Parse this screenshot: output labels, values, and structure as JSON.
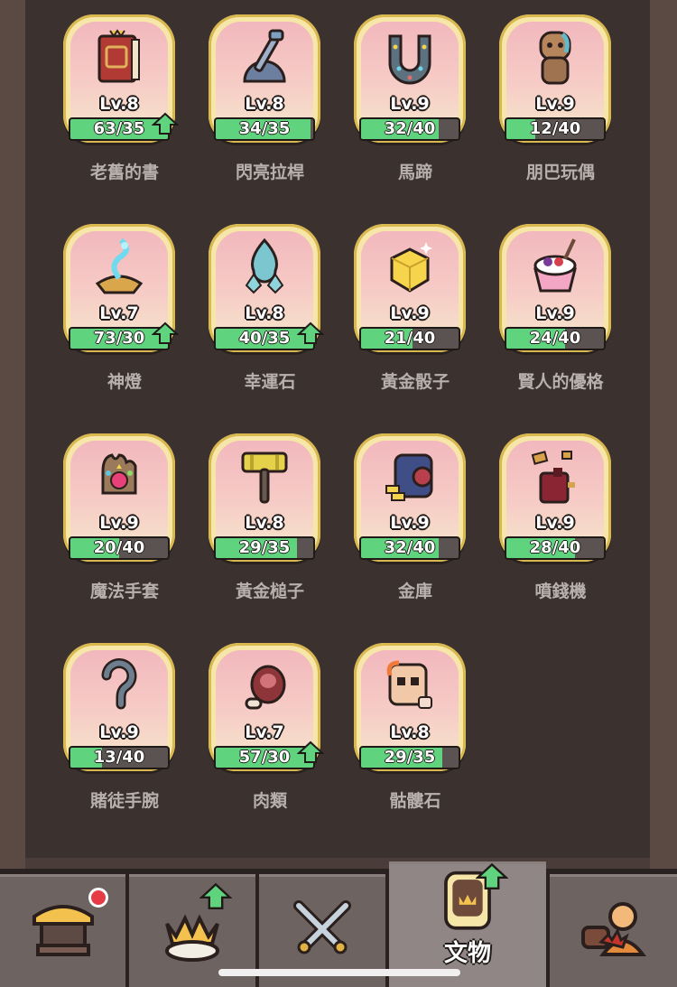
{
  "artifacts": [
    {
      "name": "老舊的書",
      "level": "Lv.8",
      "progress": "63/35",
      "fill": 1.0,
      "upgrade": true,
      "icon": "old-book-icon"
    },
    {
      "name": "閃亮拉桿",
      "level": "Lv.8",
      "progress": "34/35",
      "fill": 0.97,
      "upgrade": false,
      "icon": "shiny-lever-icon"
    },
    {
      "name": "馬蹄",
      "level": "Lv.9",
      "progress": "32/40",
      "fill": 0.8,
      "upgrade": false,
      "icon": "horseshoe-icon"
    },
    {
      "name": "朋巴玩偶",
      "level": "Lv.9",
      "progress": "12/40",
      "fill": 0.3,
      "upgrade": false,
      "icon": "doll-icon"
    },
    {
      "name": "神燈",
      "level": "Lv.7",
      "progress": "73/30",
      "fill": 1.0,
      "upgrade": true,
      "icon": "magic-lamp-icon"
    },
    {
      "name": "幸運石",
      "level": "Lv.8",
      "progress": "40/35",
      "fill": 1.0,
      "upgrade": true,
      "icon": "lucky-stone-icon"
    },
    {
      "name": "黃金骰子",
      "level": "Lv.9",
      "progress": "21/40",
      "fill": 0.525,
      "upgrade": false,
      "icon": "golden-dice-icon"
    },
    {
      "name": "賢人的優格",
      "level": "Lv.9",
      "progress": "24/40",
      "fill": 0.6,
      "upgrade": false,
      "icon": "yogurt-icon"
    },
    {
      "name": "魔法手套",
      "level": "Lv.9",
      "progress": "20/40",
      "fill": 0.5,
      "upgrade": false,
      "icon": "magic-glove-icon"
    },
    {
      "name": "黃金槌子",
      "level": "Lv.8",
      "progress": "29/35",
      "fill": 0.83,
      "upgrade": false,
      "icon": "golden-hammer-icon"
    },
    {
      "name": "金庫",
      "level": "Lv.9",
      "progress": "32/40",
      "fill": 0.8,
      "upgrade": false,
      "icon": "vault-icon"
    },
    {
      "name": "噴錢機",
      "level": "Lv.9",
      "progress": "28/40",
      "fill": 0.7,
      "upgrade": false,
      "icon": "money-machine-icon"
    },
    {
      "name": "賭徒手腕",
      "level": "Lv.9",
      "progress": "13/40",
      "fill": 0.325,
      "upgrade": false,
      "icon": "gambler-hook-icon"
    },
    {
      "name": "肉類",
      "level": "Lv.7",
      "progress": "57/30",
      "fill": 1.0,
      "upgrade": true,
      "icon": "meat-icon"
    },
    {
      "name": "骷髏石",
      "level": "Lv.8",
      "progress": "29/35",
      "fill": 0.83,
      "upgrade": false,
      "icon": "skull-stone-icon"
    }
  ],
  "nav": {
    "tabs": [
      {
        "name": "shop",
        "icon": "shop-stall-icon",
        "label": "",
        "notification": true,
        "upgrade": false
      },
      {
        "name": "crown",
        "icon": "crown-icon",
        "label": "",
        "notification": false,
        "upgrade": true
      },
      {
        "name": "battle",
        "icon": "crossed-swords-icon",
        "label": "",
        "notification": false,
        "upgrade": false
      },
      {
        "name": "artifacts",
        "icon": "artifact-card-icon",
        "label": "文物",
        "notification": false,
        "upgrade": true,
        "active": true
      },
      {
        "name": "heroes",
        "icon": "heroes-icon",
        "label": "",
        "notification": false,
        "upgrade": false
      }
    ]
  },
  "colors": {
    "progress_fill": "#5fd37e",
    "upgrade_arrow": "#5fd37e",
    "notification": "#e63b45"
  }
}
